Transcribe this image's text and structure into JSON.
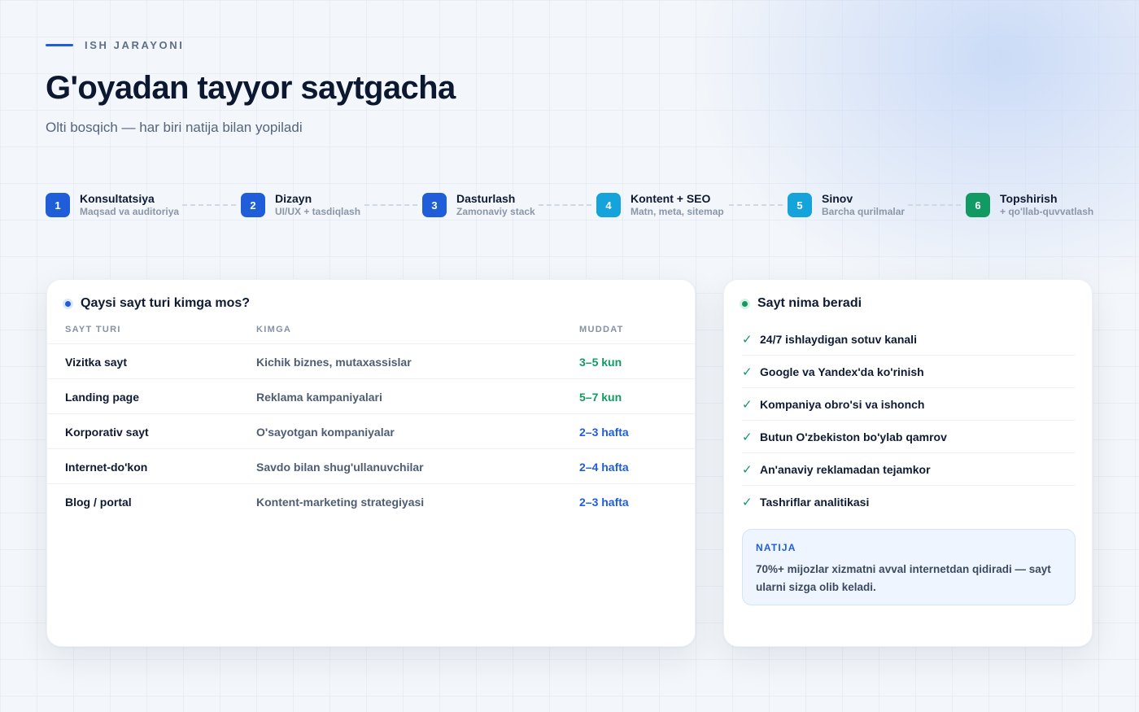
{
  "header": {
    "eyebrow": "ISH JARAYONI",
    "title": "G'oyadan tayyor saytgacha",
    "subtitle": "Olti bosqich — har biri natija bilan yopiladi"
  },
  "steps": [
    {
      "num": "1",
      "title": "Konsultatsiya",
      "sub": "Maqsad va auditoriya",
      "color": "#1f5ed8"
    },
    {
      "num": "2",
      "title": "Dizayn",
      "sub": "UI/UX + tasdiqlash",
      "color": "#1f5ed8"
    },
    {
      "num": "3",
      "title": "Dasturlash",
      "sub": "Zamonaviy stack",
      "color": "#1f5ed8"
    },
    {
      "num": "4",
      "title": "Kontent + SEO",
      "sub": "Matn, meta, sitemap",
      "color": "#15a3dc"
    },
    {
      "num": "5",
      "title": "Sinov",
      "sub": "Barcha qurilmalar",
      "color": "#15a3dc"
    },
    {
      "num": "6",
      "title": "Topshirish",
      "sub": "+ qo'llab-quvvatlash",
      "color": "#129a63"
    }
  ],
  "table": {
    "title": "Qaysi sayt turi kimga mos?",
    "headers": [
      "SAYT TURI",
      "KIMGA",
      "MUDDAT"
    ],
    "rows": [
      {
        "type": "Vizitka sayt",
        "who": "Kichik biznes, mutaxassislar",
        "duration": "3–5 kun",
        "duration_color": "#129a63"
      },
      {
        "type": "Landing page",
        "who": "Reklama kampaniyalari",
        "duration": "5–7 kun",
        "duration_color": "#129a63"
      },
      {
        "type": "Korporativ sayt",
        "who": "O'sayotgan kompaniyalar",
        "duration": "2–3 hafta",
        "duration_color": "#1f5ed8"
      },
      {
        "type": "Internet-do'kon",
        "who": "Savdo bilan shug'ullanuvchilar",
        "duration": "2–4 hafta",
        "duration_color": "#1f5ed8"
      },
      {
        "type": "Blog / portal",
        "who": "Kontent-marketing strategiyasi",
        "duration": "2–3 hafta",
        "duration_color": "#1f5ed8"
      }
    ]
  },
  "benefits": {
    "title": "Sayt nima beradi",
    "check_icon": "✓",
    "items": [
      "24/7 ishlaydigan sotuv kanali",
      "Google va Yandex'da ko'rinish",
      "Kompaniya obro'si va ishonch",
      "Butun O'zbekiston bo'ylab qamrov",
      "An'anaviy reklamadan tejamkor",
      "Tashriflar analitikasi"
    ],
    "result": {
      "label": "NATIJA",
      "text": "70%+ mijozlar xizmatni avval internetdan qidiradi — sayt ularni sizga olib keladi."
    }
  },
  "colors": {
    "accent": "#1f5ed8",
    "cyan": "#15a3dc",
    "green": "#129a63"
  }
}
